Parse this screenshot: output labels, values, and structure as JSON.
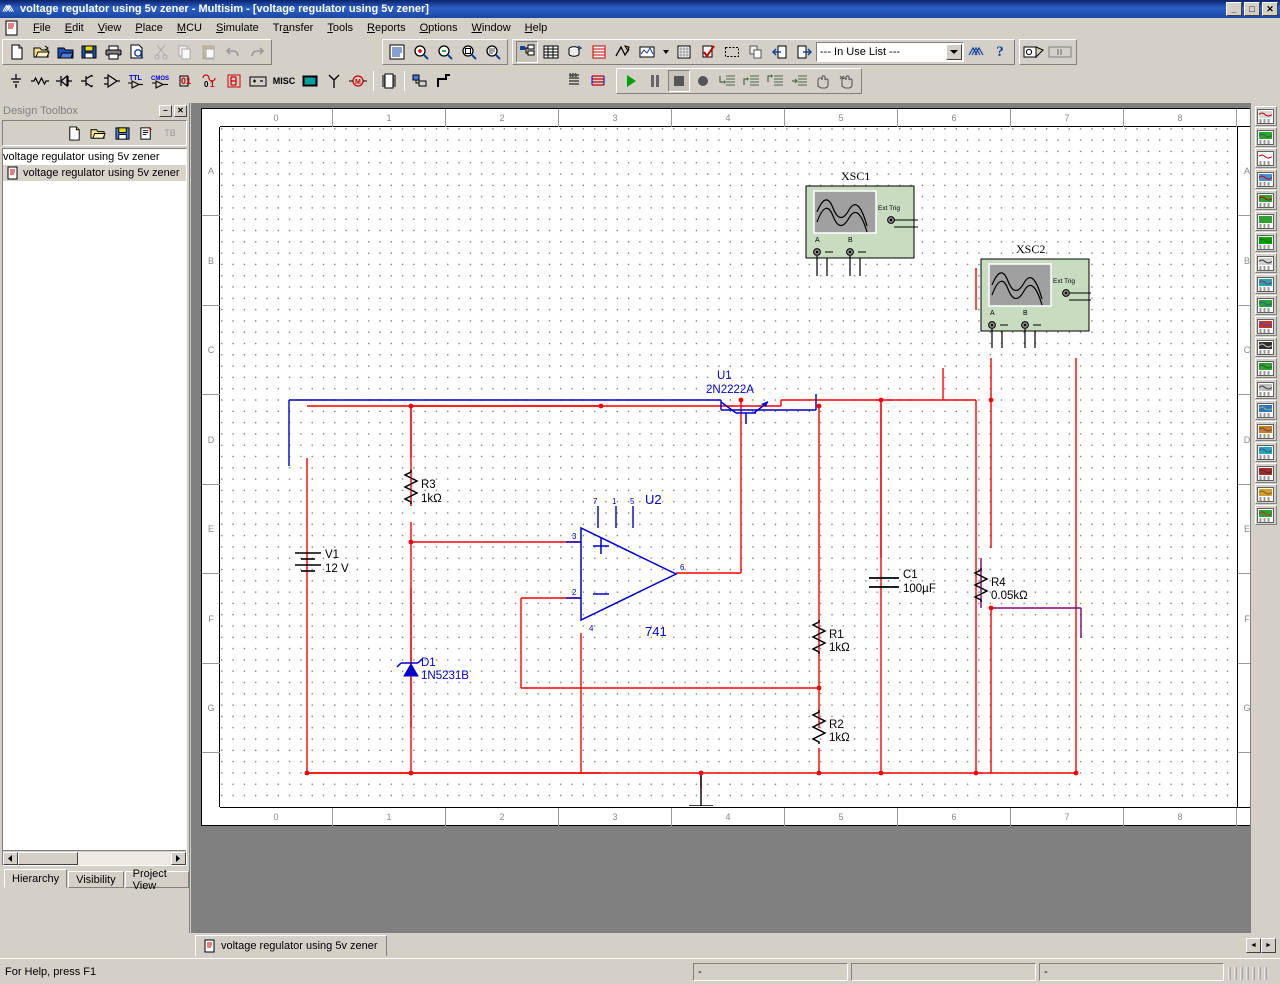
{
  "window": {
    "title": "voltage regulator using 5v zener - Multisim - [voltage regulator using 5v zener]",
    "icon": "multisim-logo-icon",
    "minimize_label": "_",
    "maximize_label": "□",
    "close_label": "✕"
  },
  "menu": {
    "items": [
      {
        "label": "File",
        "mnemonic": "F"
      },
      {
        "label": "Edit",
        "mnemonic": "E"
      },
      {
        "label": "View",
        "mnemonic": "V"
      },
      {
        "label": "Place",
        "mnemonic": "P"
      },
      {
        "label": "MCU",
        "mnemonic": "M"
      },
      {
        "label": "Simulate",
        "mnemonic": "S"
      },
      {
        "label": "Transfer",
        "mnemonic": "a"
      },
      {
        "label": "Tools",
        "mnemonic": "T"
      },
      {
        "label": "Reports",
        "mnemonic": "R"
      },
      {
        "label": "Options",
        "mnemonic": "O"
      },
      {
        "label": "Window",
        "mnemonic": "W"
      },
      {
        "label": "Help",
        "mnemonic": "H"
      }
    ]
  },
  "toolbar_standard": {
    "items": [
      {
        "name": "new-button",
        "label": "New"
      },
      {
        "name": "open-button",
        "label": "Open"
      },
      {
        "name": "open-samples-button",
        "label": "Open samples"
      },
      {
        "name": "save-button",
        "label": "Save"
      },
      {
        "name": "print-button",
        "label": "Print"
      },
      {
        "name": "print-preview-button",
        "label": "Print preview"
      },
      {
        "name": "cut-button",
        "label": "Cut"
      },
      {
        "name": "copy-button",
        "label": "Copy"
      },
      {
        "name": "paste-button",
        "label": "Paste"
      },
      {
        "name": "undo-button",
        "label": "Undo"
      },
      {
        "name": "redo-button",
        "label": "Redo"
      }
    ]
  },
  "toolbar_view": {
    "items": [
      {
        "name": "toggle-full-screen-button",
        "label": "Toggle full screen"
      },
      {
        "name": "zoom-in-button",
        "label": "Zoom in"
      },
      {
        "name": "zoom-out-button",
        "label": "Zoom out"
      },
      {
        "name": "zoom-area-button",
        "label": "Zoom area"
      },
      {
        "name": "zoom-fit-to-page-button",
        "label": "Zoom fit to page"
      }
    ]
  },
  "toolbar_main": {
    "items": [
      {
        "name": "show-design-toolbox-button",
        "label": "Show or hide Design Toolbox",
        "pressed": true
      },
      {
        "name": "show-spreadsheet-view-button",
        "label": "Show or hide Spreadsheet View"
      },
      {
        "name": "database-manager-button",
        "label": "Database Manager"
      },
      {
        "name": "component-wizard-button",
        "label": "Create Component"
      },
      {
        "name": "graphs-button",
        "label": "Grapher/Analyses list"
      },
      {
        "name": "postprocessor-button",
        "label": "Postprocessor"
      },
      {
        "name": "electrical-rules-check-button",
        "label": "Electrical Rules Check"
      },
      {
        "name": "capture-screen-area-button",
        "label": "Capture screen area"
      },
      {
        "name": "back-annotate-button",
        "label": "Back annotate from Ultiboard"
      },
      {
        "name": "forward-annotate-button",
        "label": "Forward annotate to Ultiboard"
      },
      {
        "name": "in-use-list-combo",
        "label": "--- In Use List ---"
      },
      {
        "name": "help-multisim-button",
        "label": "Multisim Help"
      },
      {
        "name": "help-button",
        "label": "Help"
      }
    ],
    "in_use_list": "--- In Use List ---",
    "in_use_list_arrow": "▼"
  },
  "toolbar_components": {
    "items": [
      {
        "name": "source-component-button",
        "label": "Place Source"
      },
      {
        "name": "basic-component-button",
        "label": "Place Basic"
      },
      {
        "name": "diode-component-button",
        "label": "Place Diode"
      },
      {
        "name": "transistor-component-button",
        "label": "Place Transistor"
      },
      {
        "name": "analog-component-button",
        "label": "Place Analog"
      },
      {
        "name": "ttl-component-button",
        "label": "Place TTL",
        "text": "TTL"
      },
      {
        "name": "cmos-component-button",
        "label": "Place CMOS",
        "text": "CMOS"
      },
      {
        "name": "misc-digital-component-button",
        "label": "Place Misc Digital"
      },
      {
        "name": "mixed-component-button",
        "label": "Place Mixed"
      },
      {
        "name": "indicator-component-button",
        "label": "Place Indicator"
      },
      {
        "name": "power-component-button",
        "label": "Place Power Component"
      },
      {
        "name": "misc-component-button",
        "label": "Place Misc",
        "text": "MISC"
      },
      {
        "name": "advanced-peripherals-button",
        "label": "Place Advanced Peripherals"
      },
      {
        "name": "rf-component-button",
        "label": "Place RF"
      },
      {
        "name": "electromechanical-component-button",
        "label": "Place Electromechanical"
      },
      {
        "name": "mcu-component-button",
        "label": "Place MCU"
      },
      {
        "name": "hierarchical-block-button",
        "label": "Place hierarchical block"
      },
      {
        "name": "bus-button",
        "label": "Place bus"
      }
    ]
  },
  "toolbar_simulation": {
    "items": [
      {
        "name": "measurement-probe-button",
        "label": "Measurement probe"
      },
      {
        "name": "grapher-button",
        "label": "Grapher"
      },
      {
        "name": "run-button",
        "label": "Run / resume simulation"
      },
      {
        "name": "pause-button",
        "label": "Pause simulation"
      },
      {
        "name": "stop-button",
        "label": "Stop simulation",
        "pressed": true
      },
      {
        "name": "record-button",
        "label": "Record"
      },
      {
        "name": "step-into-button",
        "label": "Step into"
      },
      {
        "name": "step-over-button",
        "label": "Step over"
      },
      {
        "name": "step-out-button",
        "label": "Step out"
      },
      {
        "name": "run-to-cursor-button",
        "label": "Run to cursor"
      },
      {
        "name": "pause-at-button",
        "label": "Pause at"
      },
      {
        "name": "toggle-breakpoint-button",
        "label": "Toggle breakpoint"
      }
    ]
  },
  "design_toolbox": {
    "title": "Design Toolbox",
    "minimize_label": "–",
    "close_label": "✕",
    "toolbar": [
      {
        "name": "new-design-button",
        "label": "New"
      },
      {
        "name": "open-design-button",
        "label": "Open"
      },
      {
        "name": "save-design-button",
        "label": "Save"
      },
      {
        "name": "new-sheet-button",
        "label": "New sheet"
      },
      {
        "name": "rename-button",
        "label": "TB"
      }
    ],
    "tree": [
      {
        "label": "voltage regulator using 5v zener",
        "level": 0,
        "selected": false
      },
      {
        "label": "voltage regulator using 5v zener",
        "level": 1,
        "selected": true
      }
    ],
    "tabs": [
      {
        "label": "Hierarchy",
        "active": true
      },
      {
        "label": "Visibility",
        "active": false
      },
      {
        "label": "Project View",
        "active": false
      }
    ]
  },
  "canvas": {
    "ruler_h": [
      "0",
      "1",
      "2",
      "3",
      "4",
      "5",
      "6",
      "7",
      "8"
    ],
    "ruler_v": [
      "A",
      "B",
      "C",
      "D",
      "E",
      "F",
      "G"
    ]
  },
  "schematic": {
    "title": "voltage regulator using 5v zener",
    "components": [
      {
        "ref": "V1",
        "value": "12 V",
        "type": "dc-voltage-source"
      },
      {
        "ref": "R3",
        "value": "1kΩ",
        "type": "resistor"
      },
      {
        "ref": "D1",
        "value": "1N5231B",
        "type": "zener-diode"
      },
      {
        "ref": "U1",
        "value": "2N2222A",
        "type": "npn-transistor"
      },
      {
        "ref": "U2",
        "value": "741",
        "type": "opamp"
      },
      {
        "ref": "R1",
        "value": "1kΩ",
        "type": "resistor"
      },
      {
        "ref": "R2",
        "value": "1kΩ",
        "type": "resistor"
      },
      {
        "ref": "C1",
        "value": "100µF",
        "type": "capacitor"
      },
      {
        "ref": "R4",
        "value": "0.05kΩ",
        "type": "resistor"
      },
      {
        "ref": "XSC1",
        "value": "",
        "type": "oscilloscope"
      },
      {
        "ref": "XSC2",
        "value": "",
        "type": "oscilloscope"
      }
    ],
    "opamp_pins": [
      "7",
      "1",
      "5",
      "3",
      "2",
      "6",
      "4"
    ],
    "opamp_plus": "+",
    "opamp_minus": "–",
    "scope_terminals": {
      "a": "A",
      "b": "B",
      "ext_trig": "Ext Trig"
    },
    "colors": {
      "wire_red": "#ff0000",
      "wire_blue": "#0000c8",
      "wire_purple": "#800080",
      "component": "#000000",
      "label_blue": "#0000cc",
      "instrument_body": "#c8dcc0",
      "instrument_screen": "#a0a0a0"
    }
  },
  "instruments_dock": {
    "items": [
      {
        "name": "multimeter-instrument-button",
        "label": "Multimeter"
      },
      {
        "name": "function-generator-instrument-button",
        "label": "Function generator"
      },
      {
        "name": "wattmeter-instrument-button",
        "label": "Wattmeter"
      },
      {
        "name": "oscilloscope-instrument-button",
        "label": "Oscilloscope"
      },
      {
        "name": "four-channel-oscilloscope-button",
        "label": "4 Channel oscilloscope"
      },
      {
        "name": "bode-plotter-instrument-button",
        "label": "Bode plotter"
      },
      {
        "name": "frequency-counter-instrument-button",
        "label": "Frequency counter"
      },
      {
        "name": "word-generator-instrument-button",
        "label": "Word generator"
      },
      {
        "name": "logic-converter-instrument-button",
        "label": "Logic converter"
      },
      {
        "name": "logic-analyzer-instrument-button",
        "label": "Logic analyzer"
      },
      {
        "name": "iv-analyzer-instrument-button",
        "label": "IV analyzer"
      },
      {
        "name": "distortion-analyzer-instrument-button",
        "label": "Distortion analyzer"
      },
      {
        "name": "spectrum-analyzer-instrument-button",
        "label": "Spectrum analyzer"
      },
      {
        "name": "network-analyzer-instrument-button",
        "label": "Network analyzer"
      },
      {
        "name": "agilent-function-generator-button",
        "label": "Agilent function generator"
      },
      {
        "name": "agilent-multimeter-button",
        "label": "Agilent multimeter"
      },
      {
        "name": "agilent-oscilloscope-button",
        "label": "Agilent oscilloscope"
      },
      {
        "name": "tektronix-oscilloscope-button",
        "label": "Tektronix oscilloscope"
      },
      {
        "name": "labview-instruments-button",
        "label": "LabVIEW instruments"
      },
      {
        "name": "current-probe-button",
        "label": "Current probe"
      }
    ]
  },
  "sheet_tabs": {
    "tabs": [
      {
        "label": "voltage regulator using 5v zener",
        "active": true
      }
    ],
    "scroll_left": "◄",
    "scroll_right": "►"
  },
  "statusbar": {
    "help_text": "For Help, press F1",
    "pane2": "-",
    "pane3": "",
    "pane4": "-"
  }
}
